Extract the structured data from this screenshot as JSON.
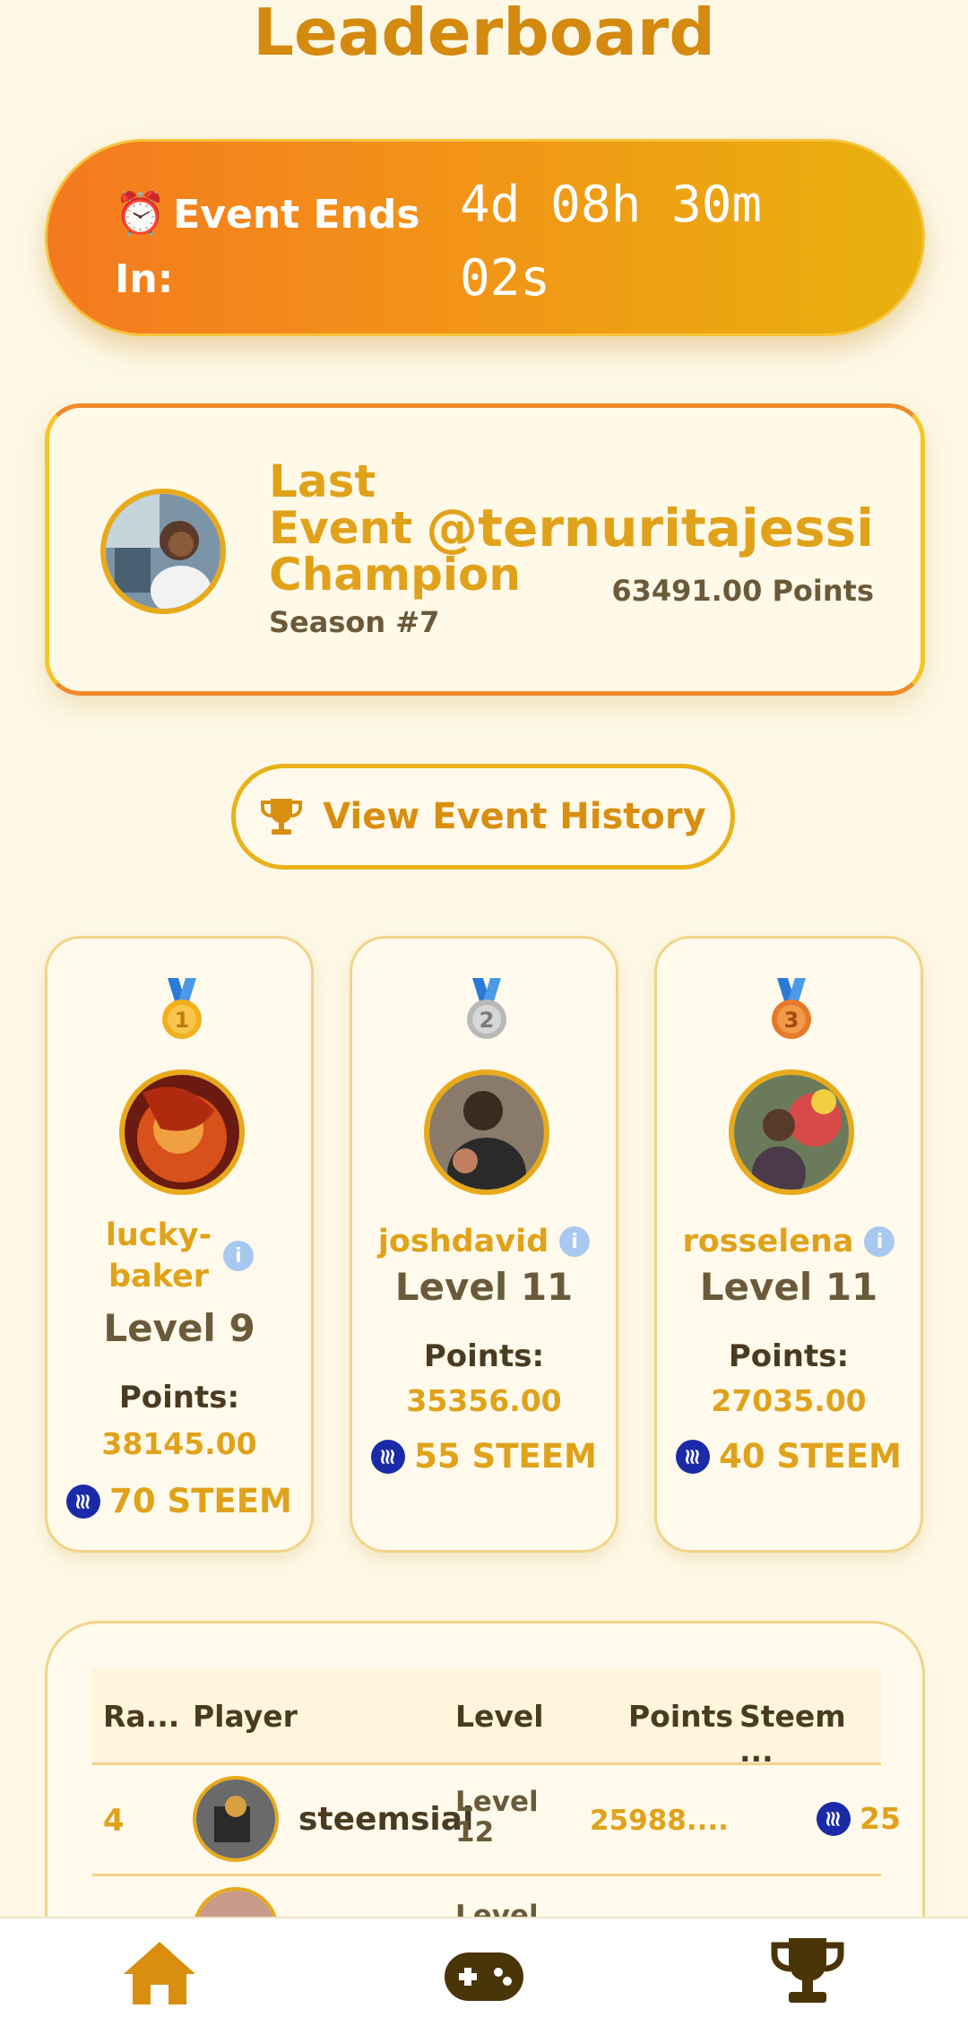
{
  "page": {
    "title": "Leaderboard"
  },
  "timer": {
    "clock_icon": "⏰",
    "label": "Event Ends In:",
    "value": "4d 08h 30m 02s"
  },
  "champion": {
    "title": "Last Event Champion",
    "season": "Season #7",
    "name": "@ternuritajessi",
    "points": "63491.00 Points"
  },
  "history_button": {
    "label": "View Event History",
    "icon": "trophy-icon"
  },
  "podium": [
    {
      "medal_color": "#f2b01e",
      "medal_number": "1",
      "name": "lucky-baker",
      "level": "Level 9",
      "points_label": "Points:",
      "points": "38145.00",
      "reward": "70 STEEM"
    },
    {
      "medal_color": "#c4c4c4",
      "medal_number": "2",
      "name": "joshdavid",
      "level": "Level 11",
      "points_label": "Points:",
      "points": "35356.00",
      "reward": "55 STEEM"
    },
    {
      "medal_color": "#e67a2a",
      "medal_number": "3",
      "name": "rosselena",
      "level": "Level 11",
      "points_label": "Points:",
      "points": "27035.00",
      "reward": "40 STEEM"
    }
  ],
  "table": {
    "headers": [
      "Ra...",
      "Player",
      "Level",
      "Points",
      "Steem ..."
    ],
    "rows": [
      {
        "rank": "4",
        "player": "steemsial",
        "level": "Level 12",
        "points": "25988....",
        "steem": "25"
      },
      {
        "rank": "",
        "player": "",
        "level": "Level",
        "points": "",
        "steem": ""
      }
    ]
  },
  "nav": {
    "items": [
      "home-icon",
      "gamepad-icon",
      "trophy-icon"
    ],
    "active_color": "#d98e10",
    "color": "#4a3508"
  },
  "colors": {
    "accent": "#e0a21a",
    "background": "#fdf8e6",
    "steem_blue": "#1a2aa8"
  }
}
